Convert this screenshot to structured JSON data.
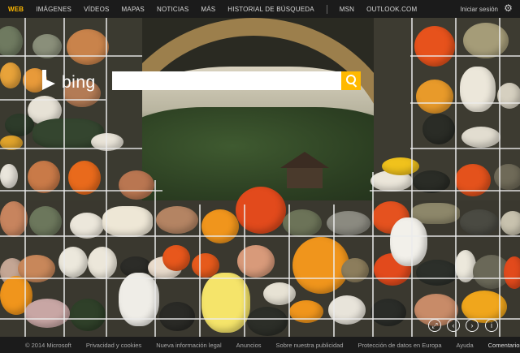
{
  "nav": {
    "items": [
      "WEB",
      "IMÁGENES",
      "VÍDEOS",
      "MAPAS",
      "NOTICIAS",
      "MÁS",
      "HISTORIAL DE BÚSQUEDA"
    ],
    "extra": [
      "MSN",
      "OUTLOOK.COM"
    ],
    "sign_in": "Iniciar sesión",
    "settings_icon": "gear-icon",
    "active_color": "#ffb900"
  },
  "logo": {
    "text": "bing"
  },
  "search": {
    "value": "",
    "button_icon": "search-icon",
    "button_color": "#ffb900"
  },
  "controls": [
    "expand-icon",
    "previous-icon",
    "next-icon",
    "info-icon"
  ],
  "footer": {
    "copyright": "© 2014 Microsoft",
    "links": [
      "Privacidad y cookies",
      "Nueva información legal",
      "Anuncios",
      "Sobre nuestra publicidad",
      "Protección de datos en Europa",
      "Ayuda",
      "Comentarios"
    ]
  }
}
